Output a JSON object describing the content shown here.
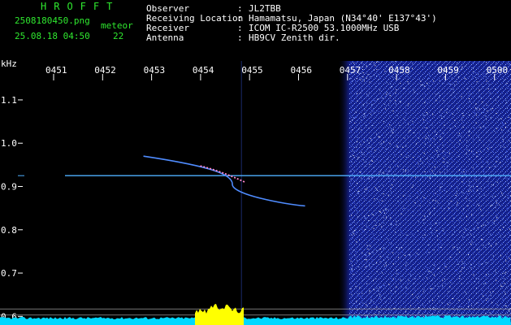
{
  "header": {
    "app_title": "HROFFT",
    "filename": "2508180450.png",
    "datetime": "25.08.18 04:50",
    "count_label": "meteor",
    "count_value": "22",
    "fields": [
      {
        "label": "Observer",
        "value": "JL2TBB"
      },
      {
        "label": "Receiving Location",
        "value": "Hamamatsu, Japan (N34°40' E137°43')"
      },
      {
        "label": "Receiver",
        "value": "ICOM IC-R2500 53.1000MHz USB"
      },
      {
        "label": "Antenna",
        "value": "HB9CV Zenith dir."
      }
    ]
  },
  "chart_data": {
    "type": "heatmap",
    "ylabel": "kHz",
    "x_ticks": [
      "0451",
      "0452",
      "0453",
      "0454",
      "0455",
      "0456",
      "0457",
      "0458",
      "0459",
      "0500"
    ],
    "y_ticks": [
      "1.1",
      "1.0",
      "0.9",
      "0.8",
      "0.7",
      "0.6"
    ],
    "ylim": [
      0.58,
      1.19
    ],
    "carrier_freq_khz": 0.925,
    "meteor_trace": {
      "start": {
        "time": "0452.8",
        "freq": 0.97
      },
      "end": {
        "time": "0456.1",
        "freq": 0.855
      }
    },
    "noise_onset_time": "0457",
    "colors": {
      "header_label": "#2fe82f",
      "carrier": "#4fb0ff",
      "noise": "#2a3cd0",
      "level_bar": "#00d8ff",
      "level_peak": "#ffff00"
    }
  }
}
